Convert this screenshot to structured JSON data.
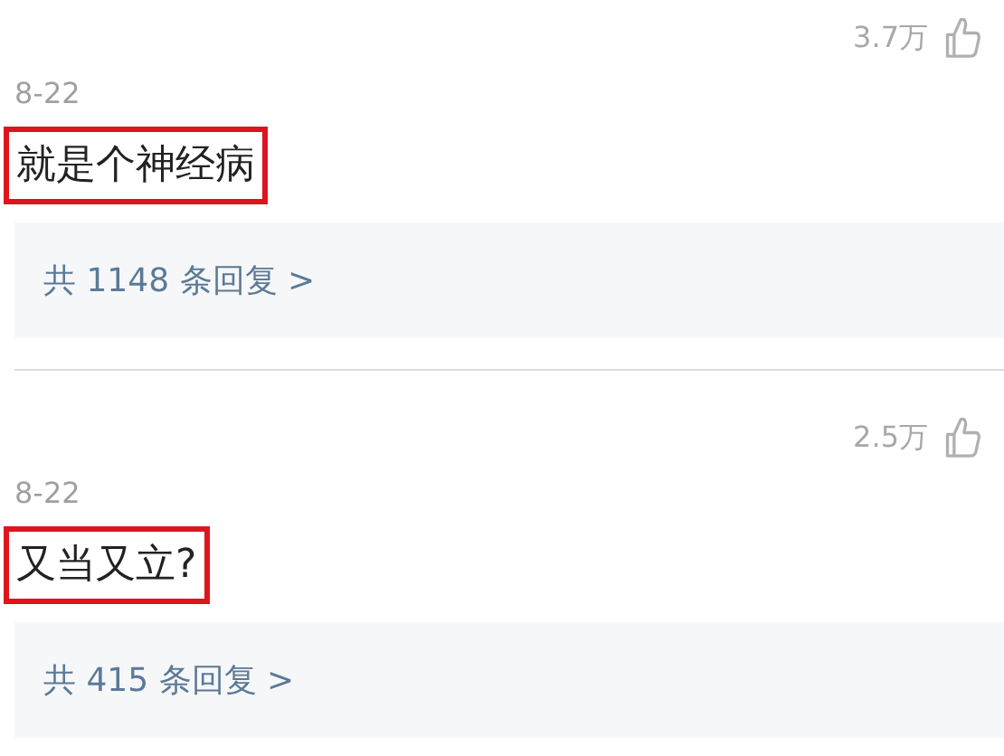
{
  "comments": [
    {
      "likes": "3.7万",
      "date": "8-22",
      "text": "就是个神经病",
      "highlighted": true,
      "replies": "共 1148 条回复 >"
    },
    {
      "likes": "2.5万",
      "date": "8-22",
      "text": "又当又立?",
      "highlighted": true,
      "replies": "共 415 条回复 >"
    }
  ]
}
